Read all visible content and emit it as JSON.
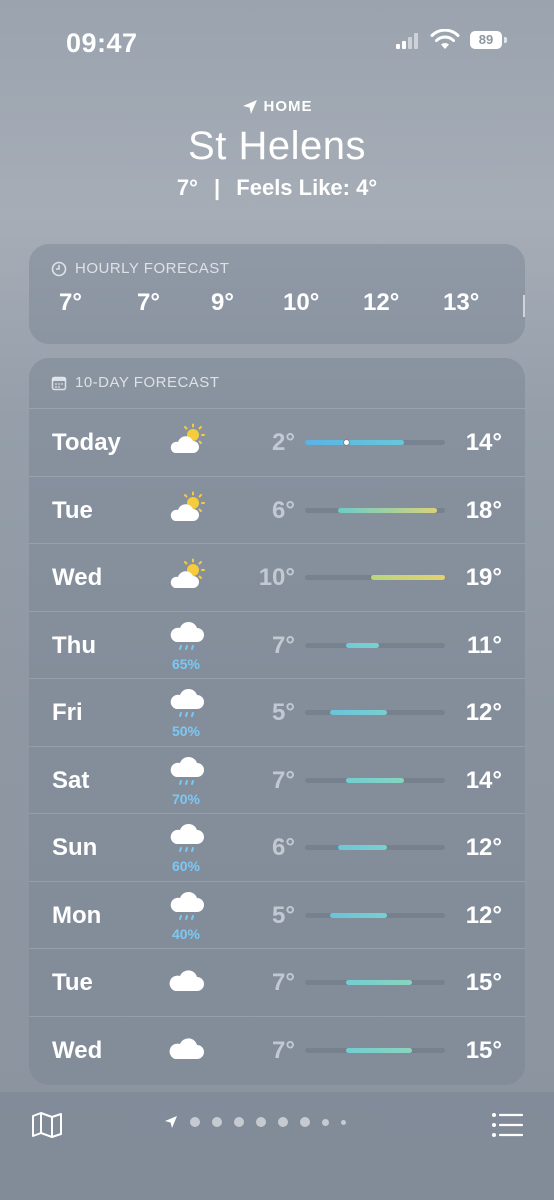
{
  "status_bar": {
    "time": "09:47",
    "battery": "89"
  },
  "location": {
    "label": "HOME",
    "city": "St Helens",
    "current_temp": "7°",
    "separator": "|",
    "feels_like": "Feels Like: 4°"
  },
  "hourly": {
    "title": "HOURLY FORECAST",
    "temps": [
      "7°",
      "7°",
      "9°",
      "10°",
      "12°",
      "13°"
    ]
  },
  "ten_day": {
    "title": "10-DAY FORECAST",
    "range_min": 2,
    "range_max": 19,
    "days": [
      {
        "day": "Today",
        "icon": "partly-sunny-icon",
        "low": "2°",
        "high": "14°",
        "low_val": 2,
        "high_val": 14,
        "current_val": 7,
        "precip": "",
        "bar_colors": [
          "#5ab3e6",
          "#66c8d8"
        ]
      },
      {
        "day": "Tue",
        "icon": "partly-sunny-icon",
        "low": "6°",
        "high": "18°",
        "low_val": 6,
        "high_val": 18,
        "precip": "",
        "bar_colors": [
          "#6dcbc9",
          "#d7d37a"
        ]
      },
      {
        "day": "Wed",
        "icon": "partly-sunny-icon",
        "low": "10°",
        "high": "19°",
        "low_val": 10,
        "high_val": 19,
        "precip": "",
        "bar_colors": [
          "#b8d67d",
          "#e4d26e"
        ]
      },
      {
        "day": "Thu",
        "icon": "rain-cloud-icon",
        "low": "7°",
        "high": "11°",
        "low_val": 7,
        "high_val": 11,
        "precip": "65%",
        "bar_colors": [
          "#6fcbd7",
          "#79d0cf"
        ]
      },
      {
        "day": "Fri",
        "icon": "rain-cloud-icon",
        "low": "5°",
        "high": "12°",
        "low_val": 5,
        "high_val": 12,
        "precip": "50%",
        "bar_colors": [
          "#68c4da",
          "#78cfd0"
        ]
      },
      {
        "day": "Sat",
        "icon": "rain-cloud-icon",
        "low": "7°",
        "high": "14°",
        "low_val": 7,
        "high_val": 14,
        "precip": "70%",
        "bar_colors": [
          "#73cdd0",
          "#86d4c0"
        ]
      },
      {
        "day": "Sun",
        "icon": "rain-cloud-icon",
        "low": "6°",
        "high": "12°",
        "low_val": 6,
        "high_val": 12,
        "precip": "60%",
        "bar_colors": [
          "#6cc8d8",
          "#7ad0ce"
        ]
      },
      {
        "day": "Mon",
        "icon": "rain-cloud-icon",
        "low": "5°",
        "high": "12°",
        "low_val": 5,
        "high_val": 12,
        "precip": "40%",
        "bar_colors": [
          "#68c4da",
          "#78cfd0"
        ]
      },
      {
        "day": "Tue",
        "icon": "cloud-icon",
        "low": "7°",
        "high": "15°",
        "low_val": 7,
        "high_val": 15,
        "precip": "",
        "bar_colors": [
          "#72cdd2",
          "#8ad4bd"
        ]
      },
      {
        "day": "Wed",
        "icon": "cloud-icon",
        "low": "7°",
        "high": "15°",
        "low_val": 7,
        "high_val": 15,
        "precip": "",
        "bar_colors": [
          "#72cdd2",
          "#8ad4bd"
        ]
      }
    ]
  },
  "bottom_bar": {
    "map_icon": "map-icon",
    "list_icon": "list-icon",
    "page_dots": 8
  }
}
